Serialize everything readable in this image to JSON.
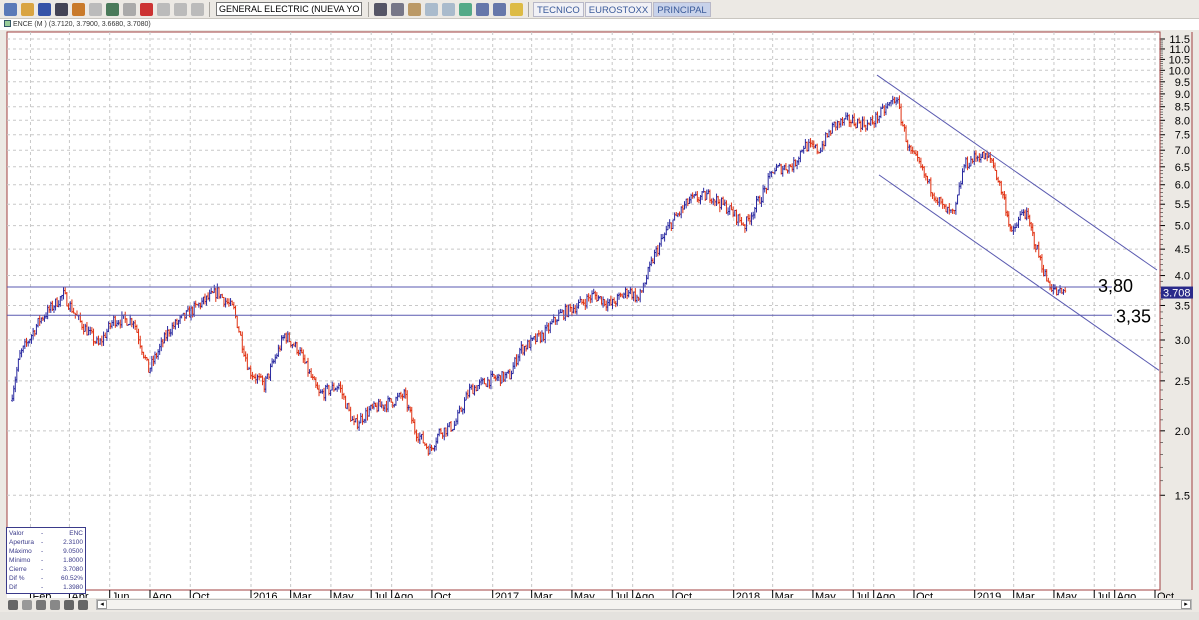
{
  "toolbar": {
    "symbol_value": "GENERAL ELECTRIC (NUEVA YORK)",
    "tabs": [
      "TECNICO",
      "EUROSTOXX",
      "PRINCIPAL"
    ],
    "active_tab": "PRINCIPAL"
  },
  "chart_title": "ENCE (M ) (3.7120, 3.7900, 3.6680, 3.7080)",
  "info": {
    "rows": [
      [
        "Valor",
        "-",
        "ENC"
      ],
      [
        "Apertura",
        "-",
        "2.3100"
      ],
      [
        "Máximo",
        "-",
        "9.0500"
      ],
      [
        "Mínimo",
        "-",
        "1.8000"
      ],
      [
        "Cierre",
        "-",
        "3.7080"
      ],
      [
        "Dif %",
        "-",
        "60.52%"
      ],
      [
        "Dif",
        "-",
        "1.3980"
      ]
    ]
  },
  "chart_data": {
    "type": "ohlc",
    "y_scale": "log",
    "ylim": [
      1.5,
      11.5
    ],
    "y_ticks": [
      "1.5",
      "2.0",
      "2.5",
      "3.0",
      "3.5",
      "4.0",
      "4.5",
      "5.0",
      "5.5",
      "6.0",
      "6.5",
      "7.0",
      "7.5",
      "8.0",
      "8.5",
      "9.0",
      "9.5",
      "10.0",
      "10.5",
      "11.0",
      "11.5"
    ],
    "x_ticks": [
      [
        "2015-02",
        "Feb"
      ],
      [
        "2015-04",
        "Abr"
      ],
      [
        "2015-06",
        "Jun"
      ],
      [
        "2015-08",
        "Ago"
      ],
      [
        "2015-10",
        "Oct"
      ],
      [
        "2016-01",
        "2016"
      ],
      [
        "2016-03",
        "Mar"
      ],
      [
        "2016-05",
        "May"
      ],
      [
        "2016-07",
        "Jul"
      ],
      [
        "2016-08",
        "Ago"
      ],
      [
        "2016-10",
        "Oct"
      ],
      [
        "2017-01",
        "2017"
      ],
      [
        "2017-03",
        "Mar"
      ],
      [
        "2017-05",
        "May"
      ],
      [
        "2017-07",
        "Jul"
      ],
      [
        "2017-08",
        "Ago"
      ],
      [
        "2017-10",
        "Oct"
      ],
      [
        "2018-01",
        "2018"
      ],
      [
        "2018-03",
        "Mar"
      ],
      [
        "2018-05",
        "May"
      ],
      [
        "2018-07",
        "Jul"
      ],
      [
        "2018-08",
        "Ago"
      ],
      [
        "2018-10",
        "Oct"
      ],
      [
        "2019-01",
        "2019"
      ],
      [
        "2019-03",
        "Mar"
      ],
      [
        "2019-05",
        "May"
      ],
      [
        "2019-07",
        "Jul"
      ],
      [
        "2019-08",
        "Ago"
      ],
      [
        "2019-10",
        "Oct"
      ]
    ],
    "grid": true,
    "last_price": "3.708",
    "up_color": "#2a2aa0",
    "down_color": "#e03010",
    "closes": [
      [
        "2015-01-02",
        2.29
      ],
      [
        "2015-01-16",
        2.8
      ],
      [
        "2015-02-15",
        3.28
      ],
      [
        "2015-03-23",
        3.67
      ],
      [
        "2015-04-15",
        3.28
      ],
      [
        "2015-05-15",
        2.93
      ],
      [
        "2015-06-07",
        3.28
      ],
      [
        "2015-07-07",
        3.28
      ],
      [
        "2015-07-30",
        2.62
      ],
      [
        "2015-08-30",
        3.14
      ],
      [
        "2015-10-14",
        3.51
      ],
      [
        "2015-11-11",
        3.72
      ],
      [
        "2015-12-06",
        3.43
      ],
      [
        "2015-12-29",
        2.62
      ],
      [
        "2016-01-21",
        2.45
      ],
      [
        "2016-02-21",
        3.07
      ],
      [
        "2016-03-13",
        2.87
      ],
      [
        "2016-04-13",
        2.35
      ],
      [
        "2016-05-13",
        2.45
      ],
      [
        "2016-06-05",
        2.05
      ],
      [
        "2016-06-28",
        2.19
      ],
      [
        "2016-08-05",
        2.29
      ],
      [
        "2016-08-20",
        2.35
      ],
      [
        "2016-09-05",
        2.01
      ],
      [
        "2016-09-28",
        1.83
      ],
      [
        "2016-10-12",
        1.99
      ],
      [
        "2016-11-04",
        2.05
      ],
      [
        "2016-11-27",
        2.4
      ],
      [
        "2016-12-27",
        2.51
      ],
      [
        "2017-01-27",
        2.56
      ],
      [
        "2017-02-11",
        2.87
      ],
      [
        "2017-03-19",
        3.07
      ],
      [
        "2017-04-11",
        3.35
      ],
      [
        "2017-05-11",
        3.51
      ],
      [
        "2017-06-03",
        3.67
      ],
      [
        "2017-06-29",
        3.51
      ],
      [
        "2017-07-26",
        3.75
      ],
      [
        "2017-08-10",
        3.59
      ],
      [
        "2017-09-03",
        4.38
      ],
      [
        "2017-09-26",
        5.01
      ],
      [
        "2017-10-26",
        5.6
      ],
      [
        "2017-11-26",
        5.73
      ],
      [
        "2017-12-26",
        5.36
      ],
      [
        "2018-01-18",
        5.01
      ],
      [
        "2018-02-17",
        5.86
      ],
      [
        "2018-03-02",
        6.41
      ],
      [
        "2018-04-02",
        6.55
      ],
      [
        "2018-04-17",
        7.16
      ],
      [
        "2018-05-10",
        7.0
      ],
      [
        "2018-06-02",
        7.83
      ],
      [
        "2018-06-25",
        8.0
      ],
      [
        "2018-07-25",
        7.83
      ],
      [
        "2018-08-17",
        8.37
      ],
      [
        "2018-09-04",
        8.87
      ],
      [
        "2018-09-14",
        7.83
      ],
      [
        "2018-09-24",
        7.0
      ],
      [
        "2018-10-09",
        6.55
      ],
      [
        "2018-10-24",
        5.99
      ],
      [
        "2018-11-16",
        5.36
      ],
      [
        "2018-12-01",
        5.24
      ],
      [
        "2018-12-16",
        6.55
      ],
      [
        "2019-01-08",
        6.85
      ],
      [
        "2019-01-27",
        6.7
      ],
      [
        "2019-02-15",
        5.6
      ],
      [
        "2019-02-26",
        4.79
      ],
      [
        "2019-03-16",
        5.36
      ],
      [
        "2019-03-23",
        5.12
      ],
      [
        "2019-04-08",
        4.38
      ],
      [
        "2019-04-20",
        3.92
      ],
      [
        "2019-05-05",
        3.7
      ],
      [
        "2019-05-18",
        3.708
      ]
    ],
    "levels": [
      {
        "value": 3.8,
        "label": "3,80"
      },
      {
        "value": 3.35,
        "label": "3,35"
      }
    ],
    "trendlines": [
      [
        [
          "2018-08-06",
          9.79
        ],
        [
          "2019-10-04",
          4.1
        ]
      ],
      [
        [
          "2018-08-09",
          6.27
        ],
        [
          "2019-10-07",
          2.62
        ]
      ]
    ]
  }
}
